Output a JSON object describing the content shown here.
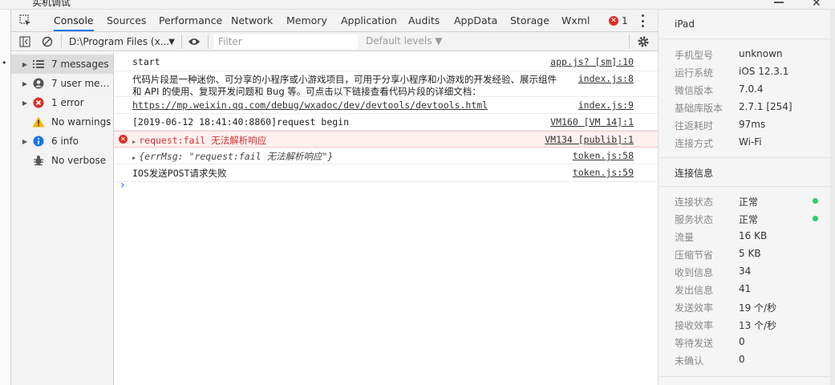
{
  "window": {
    "title": "实机调试"
  },
  "tabs": [
    {
      "label": "Console"
    },
    {
      "label": "Sources"
    },
    {
      "label": "Performance"
    },
    {
      "label": "Network"
    },
    {
      "label": "Memory"
    },
    {
      "label": "Application"
    },
    {
      "label": "Audits"
    },
    {
      "label": "AppData"
    },
    {
      "label": "Storage"
    },
    {
      "label": "Wxml"
    }
  ],
  "error_count": "1",
  "toolbar": {
    "context": "D:\\Program Files (x...",
    "filter_placeholder": "Filter",
    "levels": "Default levels ▼"
  },
  "sidebar": {
    "items": [
      {
        "label": "7 messages",
        "icon": "list-icon"
      },
      {
        "label": "7 user mess...",
        "icon": "user-icon"
      },
      {
        "label": "1 error",
        "icon": "error-icon"
      },
      {
        "label": "No warnings",
        "icon": "warning-icon"
      },
      {
        "label": "6 info",
        "icon": "info-icon"
      },
      {
        "label": "No verbose",
        "icon": "bug-icon"
      }
    ]
  },
  "console": {
    "rows": [
      {
        "msg": "start",
        "src": "app.js? [sm]:10"
      },
      {
        "msg1": "代码片段是一种迷你、可分享的小程序或小游戏项目，可用于分享小程序和小游戏的开发经验、展示组件",
        "msg2": "和 API 的使用、复现开发问题和 Bug 等。可点击以下链接查看代码片段的详细文档：",
        "src": "index.js:8"
      },
      {
        "msg": "https://mp.weixin.qq.com/debug/wxadoc/dev/devtools/devtools.html",
        "src": "index.js:9"
      },
      {
        "msg": "[2019-06-12 18:41:40:8860]request begin",
        "src": "VM160 [VM 14]:1"
      },
      {
        "msg": "request:fail 无法解析响应",
        "src": "VM134 [publib]:1"
      },
      {
        "msg": "{errMsg: \"request:fail 无法解析响应\"}",
        "src": "token.js:58"
      },
      {
        "msg": "IOS发送POST请求失败",
        "src": "token.js:59"
      }
    ]
  },
  "device": {
    "title": "iPad",
    "info": [
      {
        "k": "手机型号",
        "v": "unknown"
      },
      {
        "k": "运行系统",
        "v": "iOS 12.3.1"
      },
      {
        "k": "微信版本",
        "v": "7.0.4"
      },
      {
        "k": "基础库版本",
        "v": "2.7.1 [254]"
      },
      {
        "k": "往返耗时",
        "v": "97ms"
      },
      {
        "k": "连接方式",
        "v": "Wi-Fi"
      }
    ],
    "conn_title": "连接信息",
    "conn": [
      {
        "k": "连接状态",
        "v": "正常"
      },
      {
        "k": "服务状态",
        "v": "正常"
      },
      {
        "k": "流量",
        "v": "16 KB"
      },
      {
        "k": "压缩节省",
        "v": "5 KB"
      },
      {
        "k": "收到信息",
        "v": "34"
      },
      {
        "k": "发出信息",
        "v": "41"
      },
      {
        "k": "发送效率",
        "v": "19 个/秒"
      },
      {
        "k": "接收效率",
        "v": "13 个/秒"
      },
      {
        "k": "等待发送",
        "v": "0"
      },
      {
        "k": "未确认",
        "v": "0"
      }
    ]
  },
  "colors": {
    "accent": "#1a73e8",
    "error": "#d93025",
    "ok": "#2ecc71",
    "warning": "#f2b600",
    "info": "#1a73e8"
  }
}
